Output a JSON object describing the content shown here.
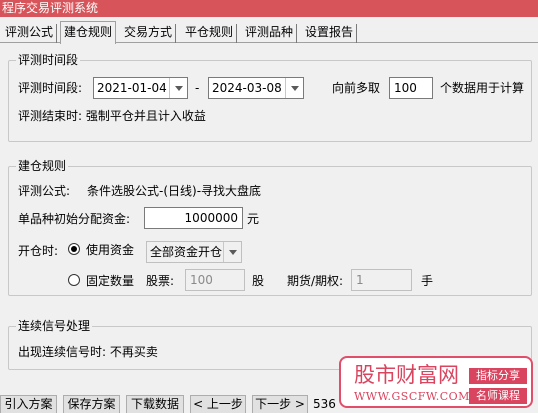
{
  "window": {
    "title": "程序交易评测系统"
  },
  "tabs": [
    {
      "label": "评测公式"
    },
    {
      "label": "建仓规则"
    },
    {
      "label": "交易方式"
    },
    {
      "label": "平仓规则"
    },
    {
      "label": "评测品种"
    },
    {
      "label": "设置报告"
    }
  ],
  "period": {
    "legend": "评测时间段",
    "label": "评测时间段:",
    "start_date": "2021-01-04",
    "separator": "-",
    "end_date": "2024-03-08",
    "lookback_prefix": "向前多取",
    "lookback_value": "100",
    "lookback_suffix": "个数据用于计算",
    "end_note": "评测结束时: 强制平仓并且计入收益"
  },
  "build": {
    "legend": "建仓规则",
    "formula_label": "评测公式:",
    "formula_value": "条件选股公式-(日线)-寻找大盘底",
    "capital_label": "单品种初始分配资金:",
    "capital_value": "1000000",
    "capital_unit": "元",
    "open_label": "开仓时:",
    "use_funds_label": "使用资金",
    "use_funds_mode": "全部资金开仓",
    "fixed_qty_label": "固定数量",
    "stock_label": "股票:",
    "stock_value": "100",
    "stock_unit": "股",
    "futures_label": "期货/期权:",
    "futures_value": "1",
    "futures_unit": "手",
    "use_funds_selected": true
  },
  "signal": {
    "legend": "连续信号处理",
    "text": "出现连续信号时: 不再买卖"
  },
  "buttons": {
    "import": "引入方案",
    "save": "保存方案",
    "download": "下载数据",
    "prev": "< 上一步",
    "next": "下一步 >",
    "truncated": "536"
  },
  "watermark": {
    "title": "股市财富网",
    "url": "WWW.GSCFW.COM",
    "tag1": "指标分享",
    "tag2": "名师课程"
  }
}
